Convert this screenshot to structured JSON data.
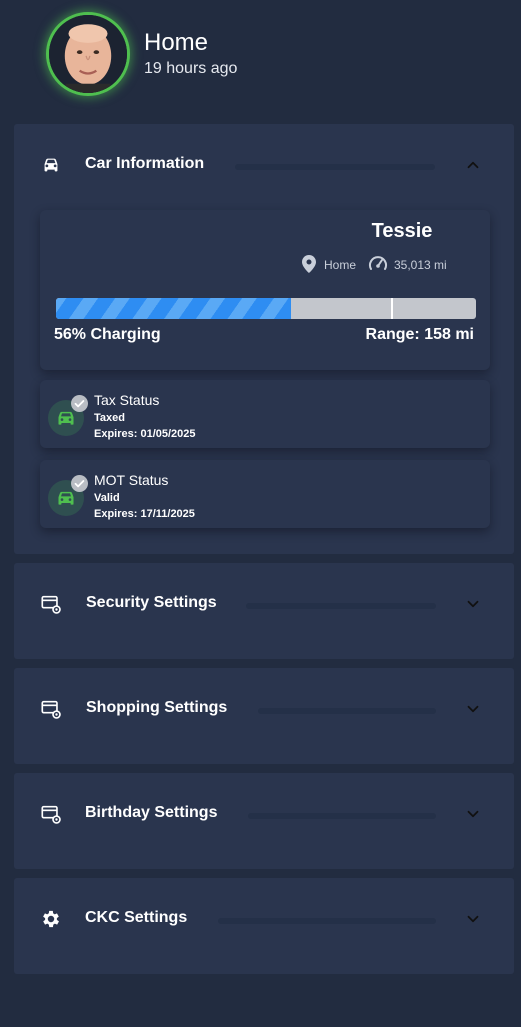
{
  "header": {
    "title": "Home",
    "subtitle": "19 hours ago",
    "avatar_icon": "person-avatar"
  },
  "car_panel": {
    "title": "Car Information",
    "icon": "car-icon",
    "expanded": true,
    "car": {
      "name": "Tessie",
      "location": "Home",
      "odometer": "35,013 mi",
      "charge_level": 56,
      "charge_label": "56% Charging",
      "charge_limit": 80,
      "range_label": "Range: 158 mi"
    },
    "statuses": [
      {
        "title": "Tax Status",
        "line1": "Taxed",
        "line2": "Expires: 01/05/2025"
      },
      {
        "title": "MOT Status",
        "line1": "Valid",
        "line2": "Expires: 17/11/2025"
      }
    ]
  },
  "panels": [
    {
      "title": "Security Settings",
      "icon": "settings-cog-icon"
    },
    {
      "title": "Shopping Settings",
      "icon": "settings-cog-icon"
    },
    {
      "title": "Birthday Settings",
      "icon": "settings-cog-icon"
    },
    {
      "title": "CKC Settings",
      "icon": "gear-icon"
    }
  ],
  "colors": {
    "background": "#222c40",
    "panel": "#2a354e",
    "accent_blue": "#2e8df2",
    "status_green": "#4fbf4f"
  }
}
